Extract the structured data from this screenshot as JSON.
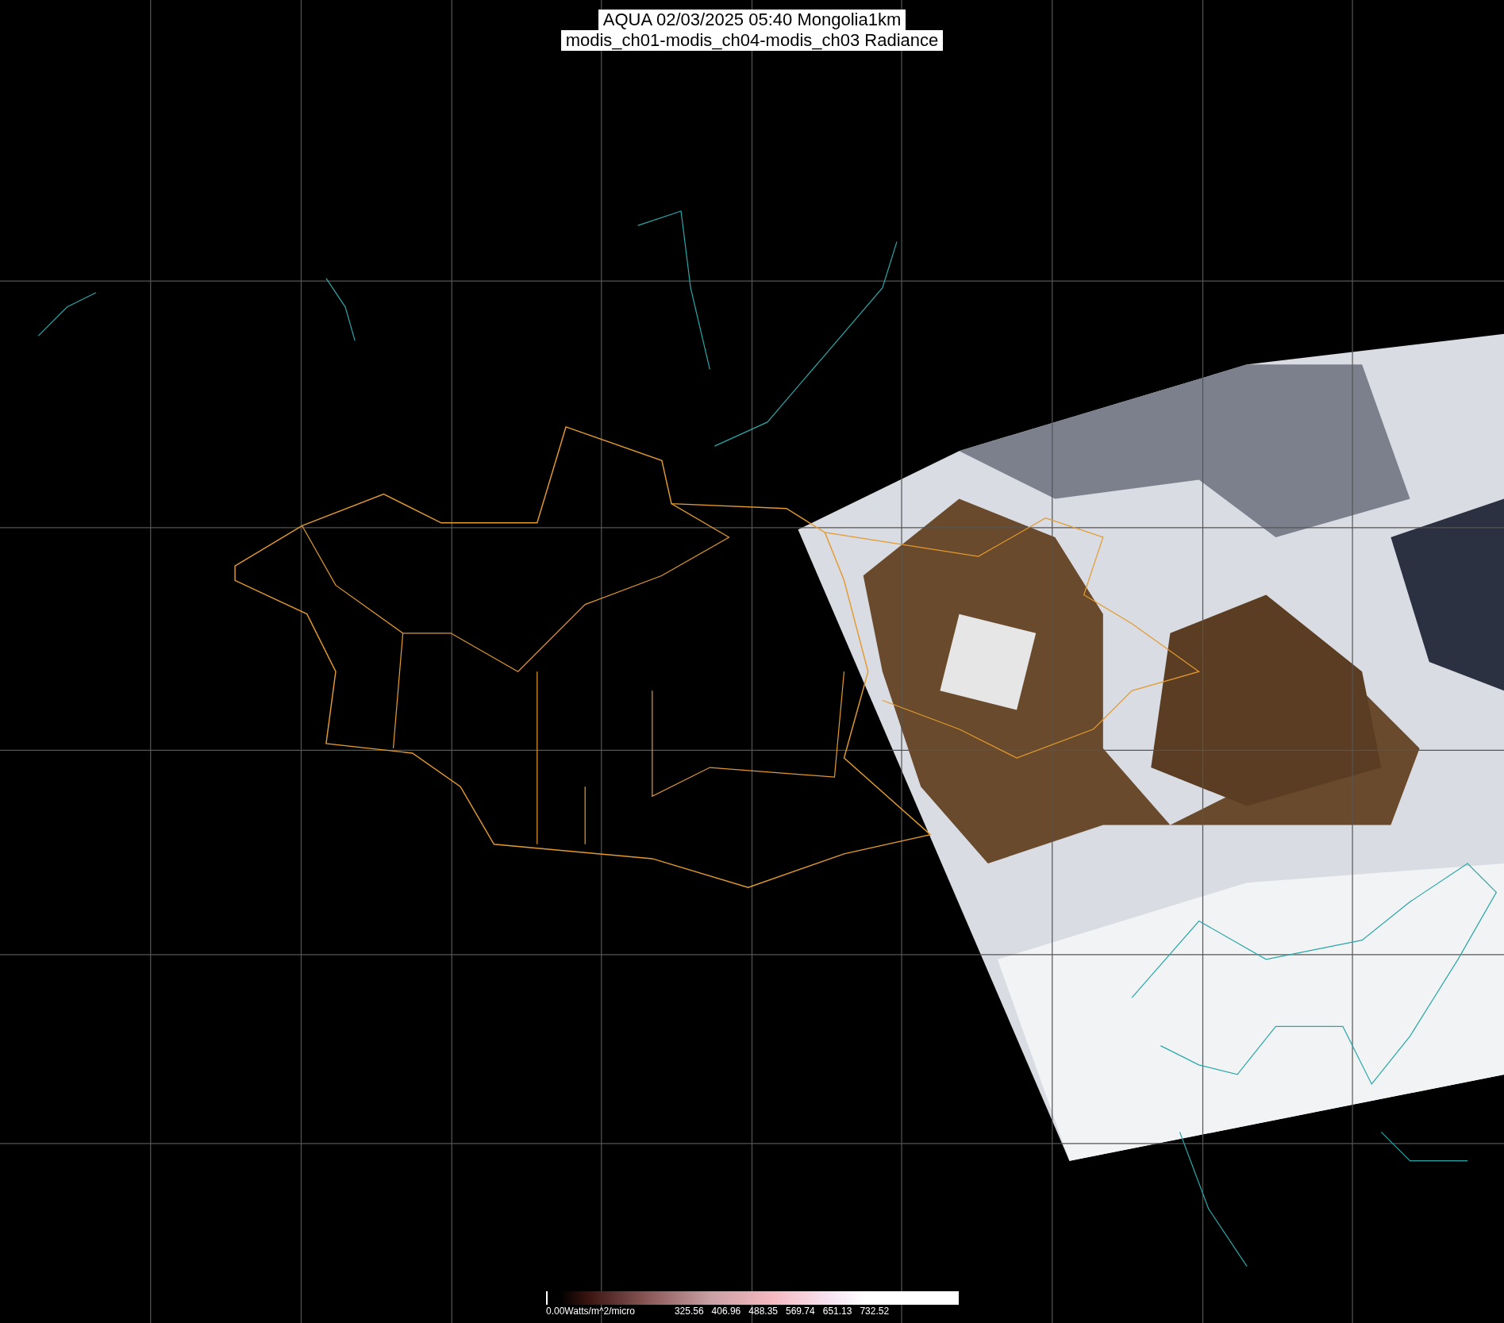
{
  "title": {
    "lines": [
      "AQUA 02/03/2025 05:40 Mongolia1km",
      "modis_ch01-modis_ch04-modis_ch03 Radiance"
    ]
  },
  "color_scale": {
    "unit_label": "0.00Watts/m^2/micro",
    "tick_labels": [
      "325.56",
      "406.96",
      "488.35",
      "569.74",
      "651.13",
      "732.52"
    ]
  }
}
